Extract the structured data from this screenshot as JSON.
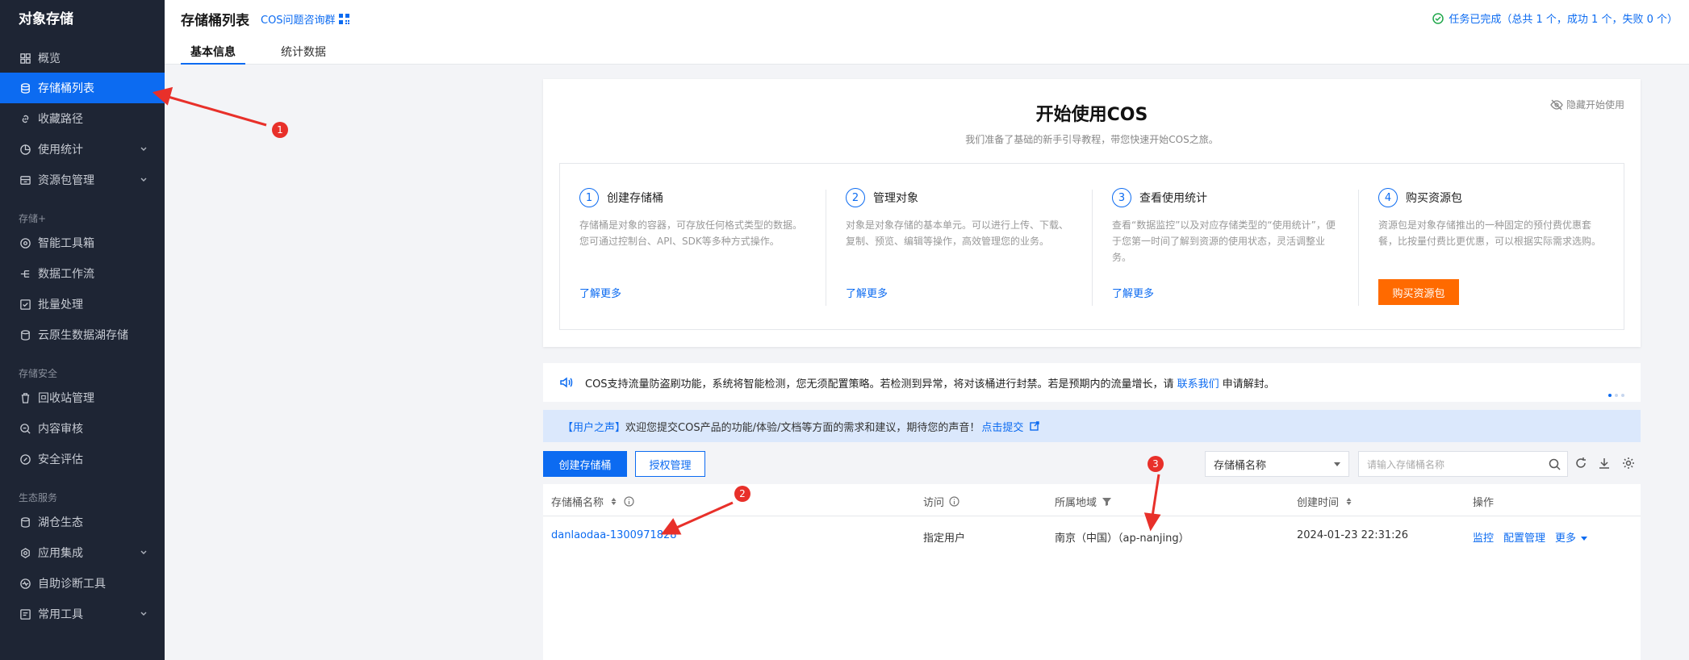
{
  "sidebar": {
    "title": "对象存储",
    "items": [
      {
        "label": "概览",
        "icon": "grid-icon"
      },
      {
        "label": "存储桶列表",
        "icon": "bucket-icon",
        "active": true
      },
      {
        "label": "收藏路径",
        "icon": "link-icon"
      },
      {
        "label": "使用统计",
        "icon": "pie-icon",
        "expandable": true
      },
      {
        "label": "资源包管理",
        "icon": "package-icon",
        "expandable": true
      },
      {
        "label": "智能工具箱",
        "icon": "toolbox-icon"
      },
      {
        "label": "数据工作流",
        "icon": "workflow-icon"
      },
      {
        "label": "批量处理",
        "icon": "batch-icon"
      },
      {
        "label": "云原生数据湖存储",
        "icon": "datalake-icon"
      },
      {
        "label": "回收站管理",
        "icon": "trash-icon"
      },
      {
        "label": "内容审核",
        "icon": "audit-icon"
      },
      {
        "label": "安全评估",
        "icon": "shield-icon"
      },
      {
        "label": "湖仓生态",
        "icon": "lakehouse-icon"
      },
      {
        "label": "应用集成",
        "icon": "integration-icon",
        "expandable": true
      },
      {
        "label": "自助诊断工具",
        "icon": "diagnose-icon"
      },
      {
        "label": "常用工具",
        "icon": "tools-icon",
        "expandable": true
      }
    ],
    "sections": [
      "存储+",
      "存储安全",
      "生态服务"
    ]
  },
  "header": {
    "title": "存储桶列表",
    "qa_link": "COS问题咨询群",
    "status": "任务已完成（总共 1 个，成功 1 个，失败 0 个）",
    "tabs": [
      "基本信息",
      "统计数据"
    ]
  },
  "start": {
    "title": "开始使用COS",
    "subtitle": "我们准备了基础的新手引导教程，带您快速开始COS之旅。",
    "hide": "隐藏开始使用",
    "steps": [
      {
        "num": "1",
        "title": "创建存储桶",
        "desc": "存储桶是对象的容器，可存放任何格式类型的数据。您可通过控制台、API、SDK等多种方式操作。",
        "link": "了解更多"
      },
      {
        "num": "2",
        "title": "管理对象",
        "desc": "对象是对象存储的基本单元。可以进行上传、下载、复制、预览、编辑等操作，高效管理您的业务。",
        "link": "了解更多"
      },
      {
        "num": "3",
        "title": "查看使用统计",
        "desc": "查看“数据监控”以及对应存储类型的“使用统计”，便于您第一时间了解到资源的使用状态，灵活调整业务。",
        "link": "了解更多"
      },
      {
        "num": "4",
        "title": "购买资源包",
        "desc": "资源包是对象存储推出的一种固定的预付费优惠套餐，比按量付费比更优惠，可以根据实际需求选购。",
        "button": "购买资源包"
      }
    ]
  },
  "notice": {
    "text_before": "COS支持流量防盗刷功能，系统将智能检测，您无须配置策略。若检测到异常，将对该桶进行封禁。若是预期内的流量增长，请",
    "link": "联系我们",
    "text_after": "申请解封。"
  },
  "voice": {
    "tag": "【用户之声】",
    "text": "欢迎您提交COS产品的功能/体验/文档等方面的需求和建议，期待您的声音！",
    "link": "点击提交"
  },
  "toolbar": {
    "create": "创建存储桶",
    "auth": "授权管理",
    "select_value": "存储桶名称",
    "search_placeholder": "请输入存储桶名称"
  },
  "table": {
    "headers": [
      "存储桶名称",
      "访问",
      "所属地域",
      "创建时间",
      "操作"
    ],
    "rows": [
      {
        "name": "danlaodaa-1300971828",
        "access": "指定用户",
        "region": "南京（中国）（ap-nanjing）",
        "created": "2024-01-23 22:31:26",
        "ops": [
          "监控",
          "配置管理",
          "更多"
        ]
      }
    ]
  },
  "annotations": [
    "1",
    "2",
    "3"
  ],
  "colors": {
    "accent": "#0c6bf1",
    "sidebar_bg": "#1e2534",
    "buy": "#ff6a00",
    "annotation": "#e8302a"
  }
}
